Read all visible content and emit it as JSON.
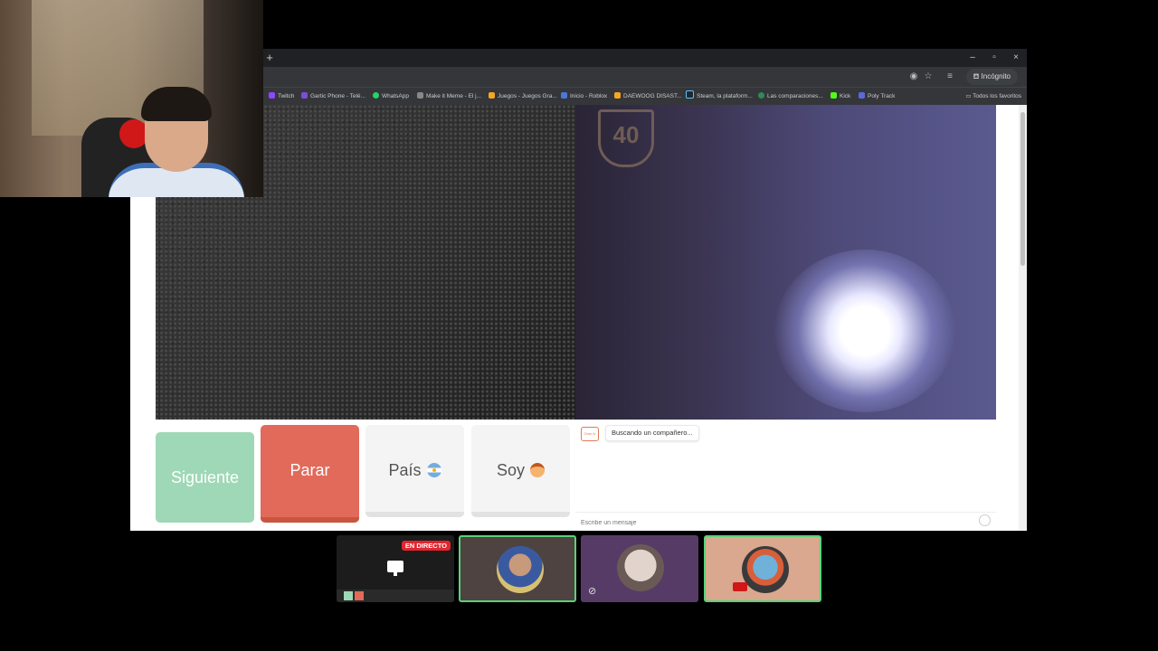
{
  "browser": {
    "new_tab_label": "+",
    "window_controls": [
      "–",
      "▫",
      "×"
    ],
    "incognito_label": "Incógnito",
    "bookmarks": [
      {
        "label": "Twitch",
        "color": "#9146ff"
      },
      {
        "label": "Gartic Phone - Telé...",
        "color": "#7a4ed8"
      },
      {
        "label": "WhatsApp",
        "color": "#25d366"
      },
      {
        "label": "Make it Meme - El j...",
        "color": "#888888"
      },
      {
        "label": "Juegos - Juegos Gra...",
        "color": "#f5a623"
      },
      {
        "label": "Inicio - Roblox",
        "color": "#4a78d8"
      },
      {
        "label": "DAEWOOG DISAST...",
        "color": "#f5a623"
      },
      {
        "label": "Steam, la plataform...",
        "color": "#1b2838"
      },
      {
        "label": "Las comparaciones...",
        "color": "#2e8b57"
      },
      {
        "label": "Kick",
        "color": "#53fc18"
      },
      {
        "label": "Poly Track",
        "color": "#5b6ad8"
      }
    ],
    "all_bookmarks_label": "Todos los favoritos"
  },
  "page": {
    "left_video_sign": "40",
    "buttons": {
      "next": "Siguiente",
      "stop": "Parar",
      "country": "País",
      "soy": "Soy"
    },
    "chat": {
      "logo_text": "Ome tv",
      "status_message": "Buscando un compañero...",
      "input_placeholder": "Escribe un mensaje"
    }
  },
  "participants": {
    "live_badge": "EN DIRECTO",
    "colors": {
      "speaking_border": "#5bd07a",
      "live_red": "#e3252e"
    }
  }
}
